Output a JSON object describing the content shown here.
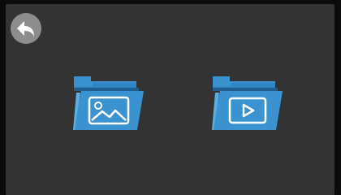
{
  "screen": {
    "background": "#333333"
  },
  "back": {
    "icon": "back-arrow-icon",
    "color": "#8d8d8d"
  },
  "folders": [
    {
      "icon": "image-folder-icon",
      "color": "#3a93d0"
    },
    {
      "icon": "video-folder-icon",
      "color": "#3a93d0"
    }
  ]
}
